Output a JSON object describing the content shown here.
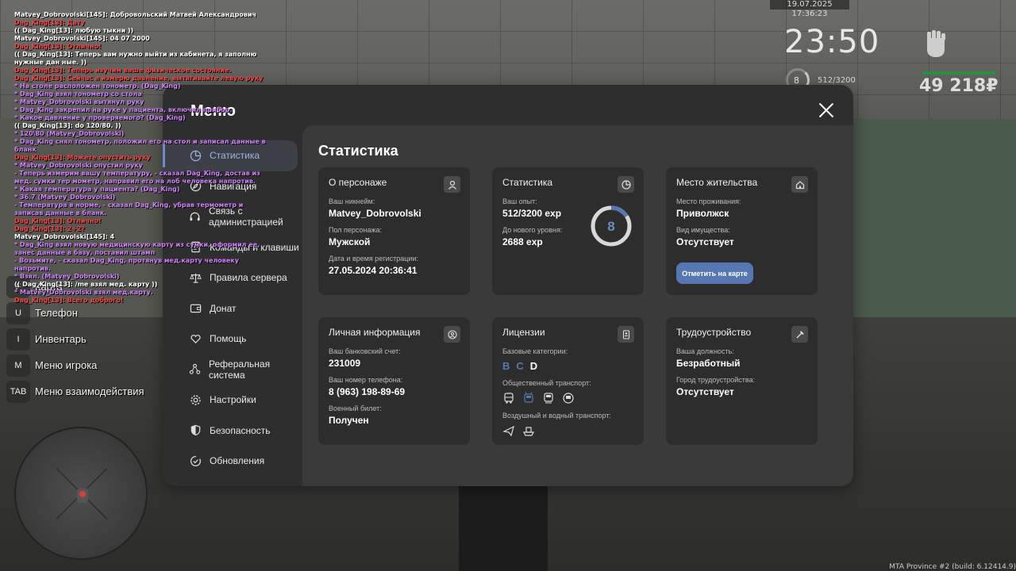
{
  "hud": {
    "date": "19.07.2025 17:36:23",
    "time": "23:50",
    "level": "8",
    "exp": "512/3200",
    "money": "49 218₽",
    "build": "MTA Province #2 (build: 6.12414.9)"
  },
  "chat": [
    {
      "text": "Matvey_Dobrovolski[145]: Добровольский Матвей Александрович",
      "color": "#ffffff"
    },
    {
      "text": "Dag_King[13]: Дату",
      "color": "#ff4040"
    },
    {
      "text": "(( Dag_King[13]: любую тыкни ))",
      "color": "#ffffff"
    },
    {
      "text": "Matvey_Dobrovolski[145]: 04 07 2000",
      "color": "#ffffff"
    },
    {
      "text": "Dag_King[13]: Отлично!",
      "color": "#ff4040"
    },
    {
      "text": "(( Dag_King[13]: Теперь вам нужно выйти из кабинета, я заполню нужные дан ные. ))",
      "color": "#ffffff"
    },
    {
      "text": "Dag_King[13]: Теперь изучим ваше физическое состояние.",
      "color": "#ff4040"
    },
    {
      "text": "Dag_King[13]: Сейчас я измерю давление, вытягивайте левую руку",
      "color": "#ff4040"
    },
    {
      "text": "* На столе расположен тонометр. (Dag_King)",
      "color": "#d27fff"
    },
    {
      "text": "* Dag_King взял тонометр со стола",
      "color": "#d27fff"
    },
    {
      "text": "* Matvey_Dobrovolski вытянул руку",
      "color": "#d27fff"
    },
    {
      "text": "* Dag_King закрепил на руке у пациента, включил прибор.",
      "color": "#d27fff"
    },
    {
      "text": "* Какое давление у проверяемого? (Dag_King)",
      "color": "#d27fff"
    },
    {
      "text": "(( Dag_King[13]: do 120/80. ))",
      "color": "#ffffff"
    },
    {
      "text": "* 120\\80 (Matvey_Dobrovolski)",
      "color": "#d27fff"
    },
    {
      "text": "* Dag_King снял тонометр, положил его на стол и записал данные в бланк",
      "color": "#d27fff"
    },
    {
      "text": "Dag_King[13]: Можете опустить руку",
      "color": "#ff4040"
    },
    {
      "text": "* Matvey_Dobrovolski опустил руку",
      "color": "#d27fff"
    },
    {
      "text": "- Теперь измерим вашу температуру, - сказал Dag_King, достав из мед. сумки тер мометр, направил его на лоб человека напротив.",
      "color": "#d27fff"
    },
    {
      "text": "* Какая температура у пациента? (Dag_King)",
      "color": "#d27fff"
    },
    {
      "text": "* 36.7 (Matvey_Dobrovolski)",
      "color": "#d27fff"
    },
    {
      "text": "- Температура в норме, - сказал Dag_King, убрав термометр и записав данные в бланк.",
      "color": "#d27fff"
    },
    {
      "text": "Dag_King[13]: Отлично!",
      "color": "#ff4040"
    },
    {
      "text": "Dag_King[13]: 2+2?",
      "color": "#ff4040"
    },
    {
      "text": "Matvey_Dobrovolski[145]: 4",
      "color": "#ffffff"
    },
    {
      "text": "* Dag_King взял новую медицинскую карту из сумки, оформил ее, занес данные в базу, поставил штамп",
      "color": "#d27fff"
    },
    {
      "text": "- Возьмите, - сказал Dag_King, протянув мед.карту человеку напротив.",
      "color": "#d27fff"
    },
    {
      "text": "* Взял. (Matvey_Dobrovolski)",
      "color": "#d27fff"
    },
    {
      "text": "(( Dag_King[13]: /me взял мед. карту ))",
      "color": "#ffffff"
    },
    {
      "text": "* Matvey_Dobrovolski взял мед.карту.",
      "color": "#d27fff"
    },
    {
      "text": "Dag_King[13]: Всего доброго!",
      "color": "#ff4040"
    }
  ],
  "quick_keys": [
    {
      "key": "F",
      "label": "Карта"
    },
    {
      "key": "U",
      "label": "Телефон"
    },
    {
      "key": "I",
      "label": "Инвентарь"
    },
    {
      "key": "M",
      "label": "Меню игрока"
    },
    {
      "key": "TAB",
      "label": "Меню взаимодействия"
    }
  ],
  "menu": {
    "title": "Меню",
    "nav": [
      {
        "icon": "pie-chart-icon",
        "label": "Статистика",
        "active": true
      },
      {
        "icon": "compass-icon",
        "label": "Навигация"
      },
      {
        "icon": "headset-icon",
        "label": "Связь с администрацией"
      },
      {
        "icon": "document-icon",
        "label": "Команды и клавиши"
      },
      {
        "icon": "scales-icon",
        "label": "Правила сервера"
      },
      {
        "icon": "wallet-icon",
        "label": "Донат"
      },
      {
        "icon": "heart-hand-icon",
        "label": "Помощь"
      },
      {
        "icon": "network-icon",
        "label": "Реферальная система"
      },
      {
        "icon": "gear-icon",
        "label": "Настройки"
      },
      {
        "icon": "shield-icon",
        "label": "Безопасность"
      },
      {
        "icon": "refresh-check-icon",
        "label": "Обновления"
      }
    ]
  },
  "stats": {
    "title": "Статистика",
    "character": {
      "title": "О персонаже",
      "nick_label": "Ваш никнейм:",
      "nick": "Matvey_Dobrovolski",
      "gender_label": "Пол персонажа:",
      "gender": "Мужской",
      "reg_label": "Дата и время регистрации:",
      "reg": "27.05.2024 20:36:41"
    },
    "progress": {
      "title": "Статистика",
      "exp_label": "Ваш опыт:",
      "exp": "512/3200 exp",
      "next_label": "До нового уровня:",
      "next": "2688 exp",
      "level": "8",
      "exp_fraction": 0.16
    },
    "residence": {
      "title": "Место жительства",
      "place_label": "Место проживания:",
      "place": "Приволжск",
      "property_label": "Вид имущества:",
      "property": "Отсутствует",
      "button": "Отметить на карте"
    },
    "personal": {
      "title": "Личная информация",
      "bank_label": "Ваш банковский счет:",
      "bank": "231009",
      "phone_label": "Ваш номер телефона:",
      "phone": "8 (963) 198-89-69",
      "military_label": "Военный билет:",
      "military": "Получен"
    },
    "licenses": {
      "title": "Лицензии",
      "base_label": "Базовые категории:",
      "categories": [
        {
          "name": "B",
          "color": "#5677b3"
        },
        {
          "name": "C",
          "color": "#5677b3"
        },
        {
          "name": "D",
          "color": "#ffffff"
        }
      ],
      "public_label": "Общественный транспорт:",
      "air_label": "Воздушный и водный транспорт:"
    },
    "employment": {
      "title": "Трудоустройство",
      "position_label": "Ваша должность:",
      "position": "Безработный",
      "city_label": "Город трудоустройства:",
      "city": "Отсутствует"
    }
  },
  "colors": {
    "accent": "#5677b3",
    "panel": "#2e2e2e",
    "card": "#2d2d2d"
  }
}
